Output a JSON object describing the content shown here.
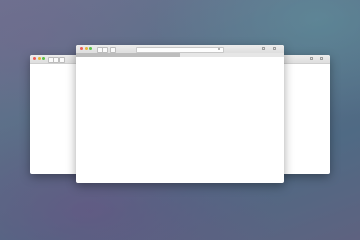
{
  "background": {
    "base_colors": [
      "#6c7290",
      "#5a7088",
      "#4f6a84"
    ],
    "tint_colors": [
      "#6e4e82",
      "#5f96a0"
    ]
  },
  "windows": [
    {
      "role": "back-left",
      "buttons": [
        "red",
        "yellow",
        "green"
      ],
      "nav": [
        "back",
        "forward"
      ]
    },
    {
      "role": "back-right",
      "buttons": [],
      "nav": [
        "share",
        "tabs"
      ]
    },
    {
      "role": "front",
      "buttons": [
        "red",
        "yellow",
        "green"
      ],
      "nav": [
        "back",
        "forward",
        "sidebar",
        "share",
        "tabs"
      ]
    }
  ],
  "traffic_light_colors": {
    "close": "#ec5f57",
    "minimize": "#e4b53a",
    "zoom": "#5cc04a"
  },
  "icons": [
    "close-icon",
    "minimize-icon",
    "zoom-icon",
    "back-icon",
    "forward-icon",
    "sidebar-icon",
    "share-icon",
    "tabs-icon",
    "reload-icon"
  ]
}
